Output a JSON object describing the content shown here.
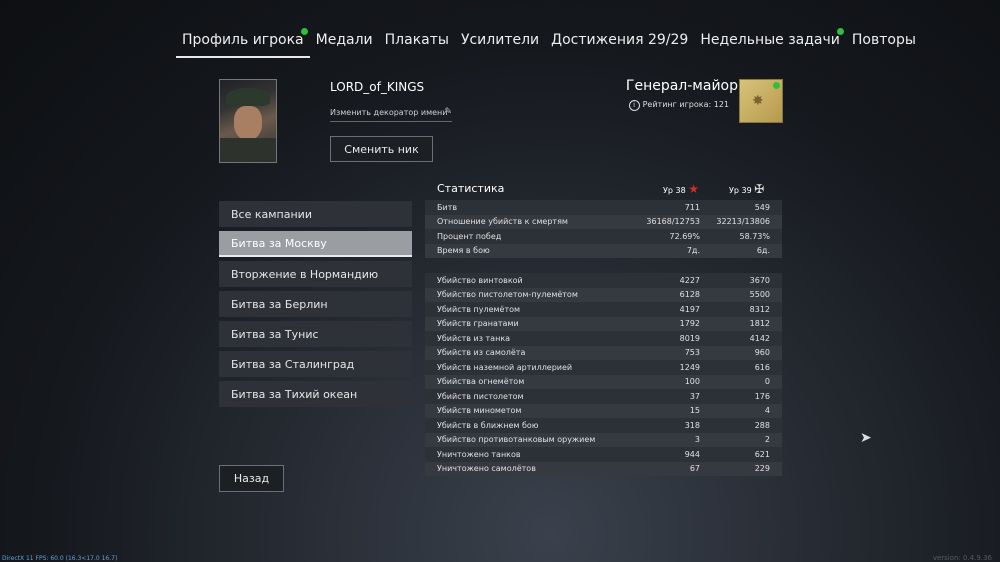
{
  "tabs": [
    {
      "label": "Профиль игрока",
      "active": true,
      "notify": true
    },
    {
      "label": "Медали",
      "active": false,
      "notify": false
    },
    {
      "label": "Плакаты",
      "active": false,
      "notify": false
    },
    {
      "label": "Усилители",
      "active": false,
      "notify": false
    },
    {
      "label": "Достижения 29/29",
      "active": false,
      "notify": false
    },
    {
      "label": "Недельные задачи",
      "active": false,
      "notify": true
    },
    {
      "label": "Повторы",
      "active": false,
      "notify": false
    }
  ],
  "profile": {
    "username": "LORD_of_KINGS",
    "decorator_label": "Изменить декоратор имени",
    "change_nick_label": "Сменить ник",
    "rank_title": "Генерал-майор",
    "rating_text": "Рейтинг игрока: 121"
  },
  "campaigns": [
    {
      "label": "Все кампании",
      "active": false
    },
    {
      "label": "Битва за Москву",
      "active": true
    },
    {
      "label": "Вторжение в Нормандию",
      "active": false
    },
    {
      "label": "Битва за Берлин",
      "active": false
    },
    {
      "label": "Битва за Тунис",
      "active": false
    },
    {
      "label": "Битва за Сталинград",
      "active": false
    },
    {
      "label": "Битва за Тихий океан",
      "active": false
    }
  ],
  "back_label": "Назад",
  "stats": {
    "title": "Статистика",
    "level_a": "Ур 38",
    "level_b": "Ур 39",
    "group1": [
      {
        "label": "Битв",
        "a": "711",
        "b": "549"
      },
      {
        "label": "Отношение убийств к смертям",
        "a": "36168/12753",
        "b": "32213/13806"
      },
      {
        "label": "Процент побед",
        "a": "72.69%",
        "b": "58.73%"
      },
      {
        "label": "Время в бою",
        "a": "7д.",
        "b": "6д."
      }
    ],
    "group2": [
      {
        "label": "Убийство винтовкой",
        "a": "4227",
        "b": "3670"
      },
      {
        "label": "Убийство пистолетом-пулемётом",
        "a": "6128",
        "b": "5500"
      },
      {
        "label": "Убийств пулемётом",
        "a": "4197",
        "b": "8312"
      },
      {
        "label": "Убийств гранатами",
        "a": "1792",
        "b": "1812"
      },
      {
        "label": "Убийств из танка",
        "a": "8019",
        "b": "4142"
      },
      {
        "label": "Убийств из самолёта",
        "a": "753",
        "b": "960"
      },
      {
        "label": "Убийств наземной артиллерией",
        "a": "1249",
        "b": "616"
      },
      {
        "label": "Убийства огнемётом",
        "a": "100",
        "b": "0"
      },
      {
        "label": "Убийств пистолетом",
        "a": "37",
        "b": "176"
      },
      {
        "label": "Убийств минометом",
        "a": "15",
        "b": "4"
      },
      {
        "label": "Убийств в ближнем бою",
        "a": "318",
        "b": "288"
      },
      {
        "label": "Убийство противотанковым оружием",
        "a": "3",
        "b": "2"
      },
      {
        "label": "Уничтожено танков",
        "a": "944",
        "b": "621"
      },
      {
        "label": "Уничтожено самолётов",
        "a": "67",
        "b": "229"
      }
    ]
  },
  "fps_text": "DirectX 11 FPS: 60.0 (16.3<17.0 16.7)",
  "version_text": "version: 0.4.9.36"
}
